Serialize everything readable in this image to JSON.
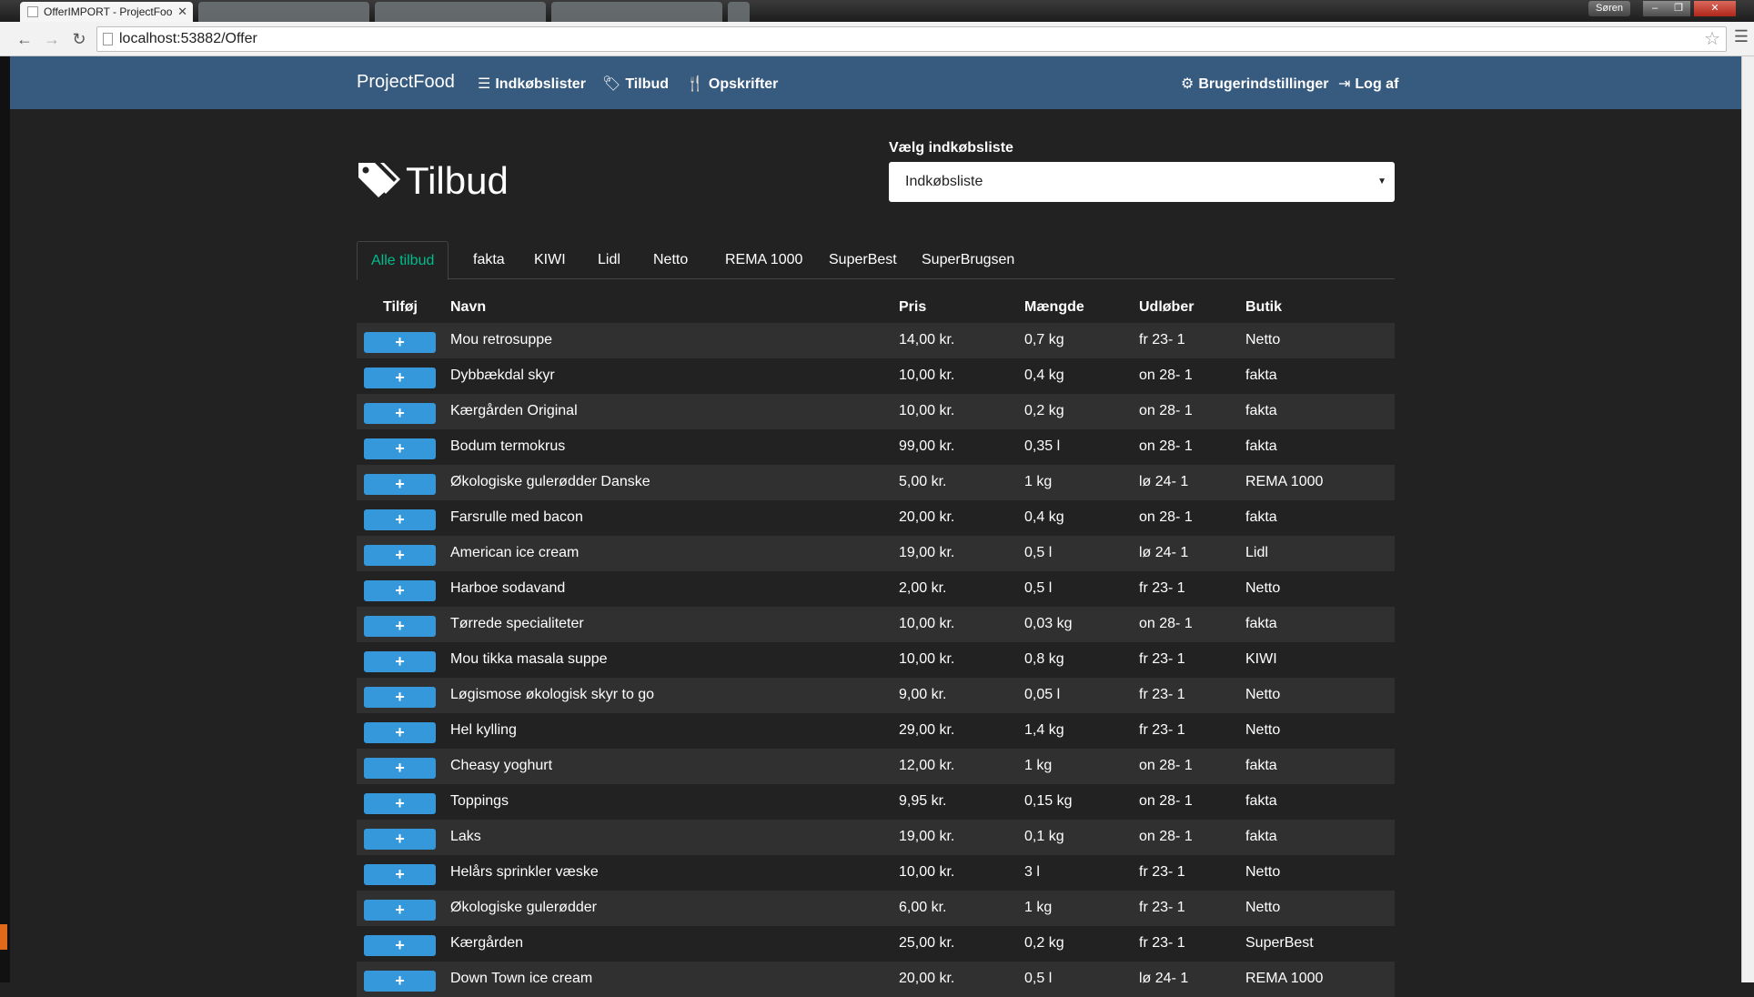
{
  "browser": {
    "active_tab_title": "OfferIMPORT - ProjectFoo",
    "user_name": "Søren",
    "url": "localhost:53882/Offer"
  },
  "navbar": {
    "brand": "ProjectFood",
    "links": [
      {
        "label": "Indkøbslister",
        "icon": "list-icon"
      },
      {
        "label": "Tilbud",
        "icon": "tags-icon"
      },
      {
        "label": "Opskrifter",
        "icon": "cutlery-icon"
      }
    ],
    "right_links": [
      {
        "label": "Brugerindstillinger",
        "icon": "gear-icon"
      },
      {
        "label": "Log af",
        "icon": "log-out-icon"
      }
    ]
  },
  "page": {
    "title": "Tilbud",
    "select_label": "Vælg indkøbsliste",
    "select_value": "Indkøbsliste"
  },
  "tabs": [
    "Alle tilbud",
    "fakta",
    "KIWI",
    "Lidl",
    "Netto",
    "REMA 1000",
    "SuperBest",
    "SuperBrugsen"
  ],
  "active_tab": "Alle tilbud",
  "table": {
    "headers": {
      "add": "Tilføj",
      "name": "Navn",
      "price": "Pris",
      "qty": "Mængde",
      "expires": "Udløber",
      "shop": "Butik"
    },
    "add_label": "+",
    "rows": [
      {
        "name": "Mou retrosuppe",
        "price": "14,00 kr.",
        "qty": "0,7 kg",
        "expires": "fr 23- 1",
        "shop": "Netto"
      },
      {
        "name": "Dybbækdal skyr",
        "price": "10,00 kr.",
        "qty": "0,4 kg",
        "expires": "on 28- 1",
        "shop": "fakta"
      },
      {
        "name": "Kærgården Original",
        "price": "10,00 kr.",
        "qty": "0,2 kg",
        "expires": "on 28- 1",
        "shop": "fakta"
      },
      {
        "name": "Bodum termokrus",
        "price": "99,00 kr.",
        "qty": "0,35 l",
        "expires": "on 28- 1",
        "shop": "fakta"
      },
      {
        "name": "Økologiske gulerødder Danske",
        "price": "5,00 kr.",
        "qty": "1 kg",
        "expires": "lø 24- 1",
        "shop": "REMA 1000"
      },
      {
        "name": "Farsrulle med bacon",
        "price": "20,00 kr.",
        "qty": "0,4 kg",
        "expires": "on 28- 1",
        "shop": "fakta"
      },
      {
        "name": "American ice cream",
        "price": "19,00 kr.",
        "qty": "0,5 l",
        "expires": "lø 24- 1",
        "shop": "Lidl"
      },
      {
        "name": "Harboe sodavand",
        "price": "2,00 kr.",
        "qty": "0,5 l",
        "expires": "fr 23- 1",
        "shop": "Netto"
      },
      {
        "name": "Tørrede specialiteter",
        "price": "10,00 kr.",
        "qty": "0,03 kg",
        "expires": "on 28- 1",
        "shop": "fakta"
      },
      {
        "name": "Mou tikka masala suppe",
        "price": "10,00 kr.",
        "qty": "0,8 kg",
        "expires": "fr 23- 1",
        "shop": "KIWI"
      },
      {
        "name": "Løgismose økologisk skyr to go",
        "price": "9,00 kr.",
        "qty": "0,05 l",
        "expires": "fr 23- 1",
        "shop": "Netto"
      },
      {
        "name": "Hel kylling",
        "price": "29,00 kr.",
        "qty": "1,4 kg",
        "expires": "fr 23- 1",
        "shop": "Netto"
      },
      {
        "name": "Cheasy yoghurt",
        "price": "12,00 kr.",
        "qty": "1 kg",
        "expires": "on 28- 1",
        "shop": "fakta"
      },
      {
        "name": "Toppings",
        "price": "9,95 kr.",
        "qty": "0,15 kg",
        "expires": "on 28- 1",
        "shop": "fakta"
      },
      {
        "name": "Laks",
        "price": "19,00 kr.",
        "qty": "0,1 kg",
        "expires": "on 28- 1",
        "shop": "fakta"
      },
      {
        "name": "Helårs sprinkler væske",
        "price": "10,00 kr.",
        "qty": "3 l",
        "expires": "fr 23- 1",
        "shop": "Netto"
      },
      {
        "name": "Økologiske gulerødder",
        "price": "6,00 kr.",
        "qty": "1 kg",
        "expires": "fr 23- 1",
        "shop": "Netto"
      },
      {
        "name": "Kærgården",
        "price": "25,00 kr.",
        "qty": "0,2 kg",
        "expires": "fr 23- 1",
        "shop": "SuperBest"
      },
      {
        "name": "Down Town ice cream",
        "price": "20,00 kr.",
        "qty": "0,5 l",
        "expires": "lø 24- 1",
        "shop": "REMA 1000"
      }
    ]
  },
  "colors": {
    "navbar": "#375a7f",
    "background": "#222222",
    "row_stripe": "#303030",
    "add_button": "#3498db",
    "active_tab": "#00bc8c"
  }
}
